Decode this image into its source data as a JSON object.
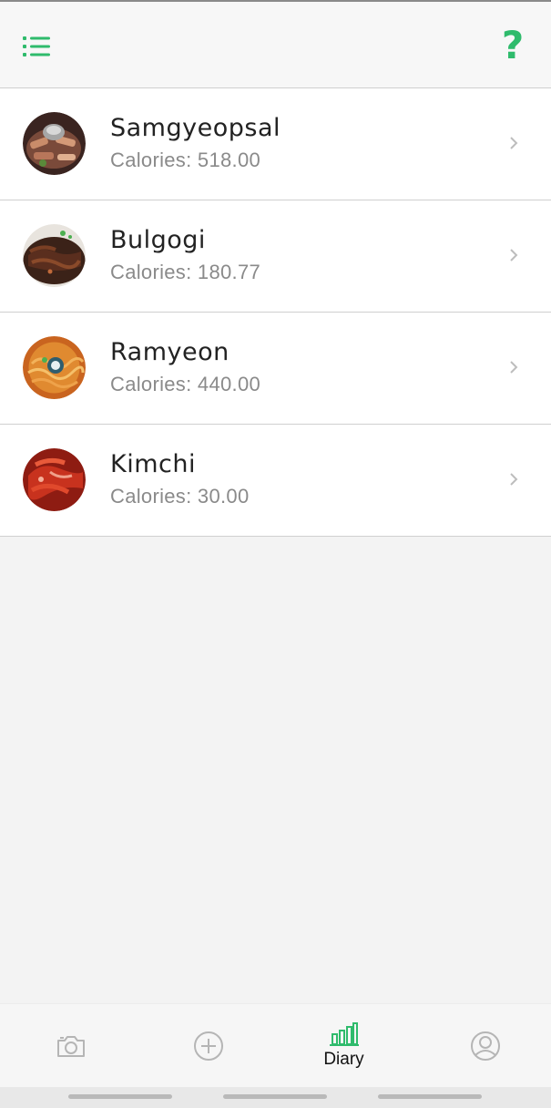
{
  "header": {
    "menu_icon": "list-icon",
    "help_icon": "question-mark-icon",
    "help_label": "?",
    "accent_color": "#2fbb6c"
  },
  "foods": [
    {
      "name": "Samgyeopsal",
      "calories": "Calories: 518.00",
      "image": "samgyeopsal-photo"
    },
    {
      "name": "Bulgogi",
      "calories": "Calories: 180.77",
      "image": "bulgogi-photo"
    },
    {
      "name": "Ramyeon",
      "calories": "Calories: 440.00",
      "image": "ramyeon-photo"
    },
    {
      "name": "Kimchi",
      "calories": "Calories: 30.00",
      "image": "kimchi-photo"
    }
  ],
  "bottom_nav": {
    "active": "diary",
    "items": [
      {
        "id": "camera",
        "icon": "camera-icon",
        "label": ""
      },
      {
        "id": "add",
        "icon": "plus-circle-icon",
        "label": ""
      },
      {
        "id": "diary",
        "icon": "bar-chart-icon",
        "label": "Diary"
      },
      {
        "id": "profile",
        "icon": "user-circle-icon",
        "label": ""
      }
    ]
  }
}
